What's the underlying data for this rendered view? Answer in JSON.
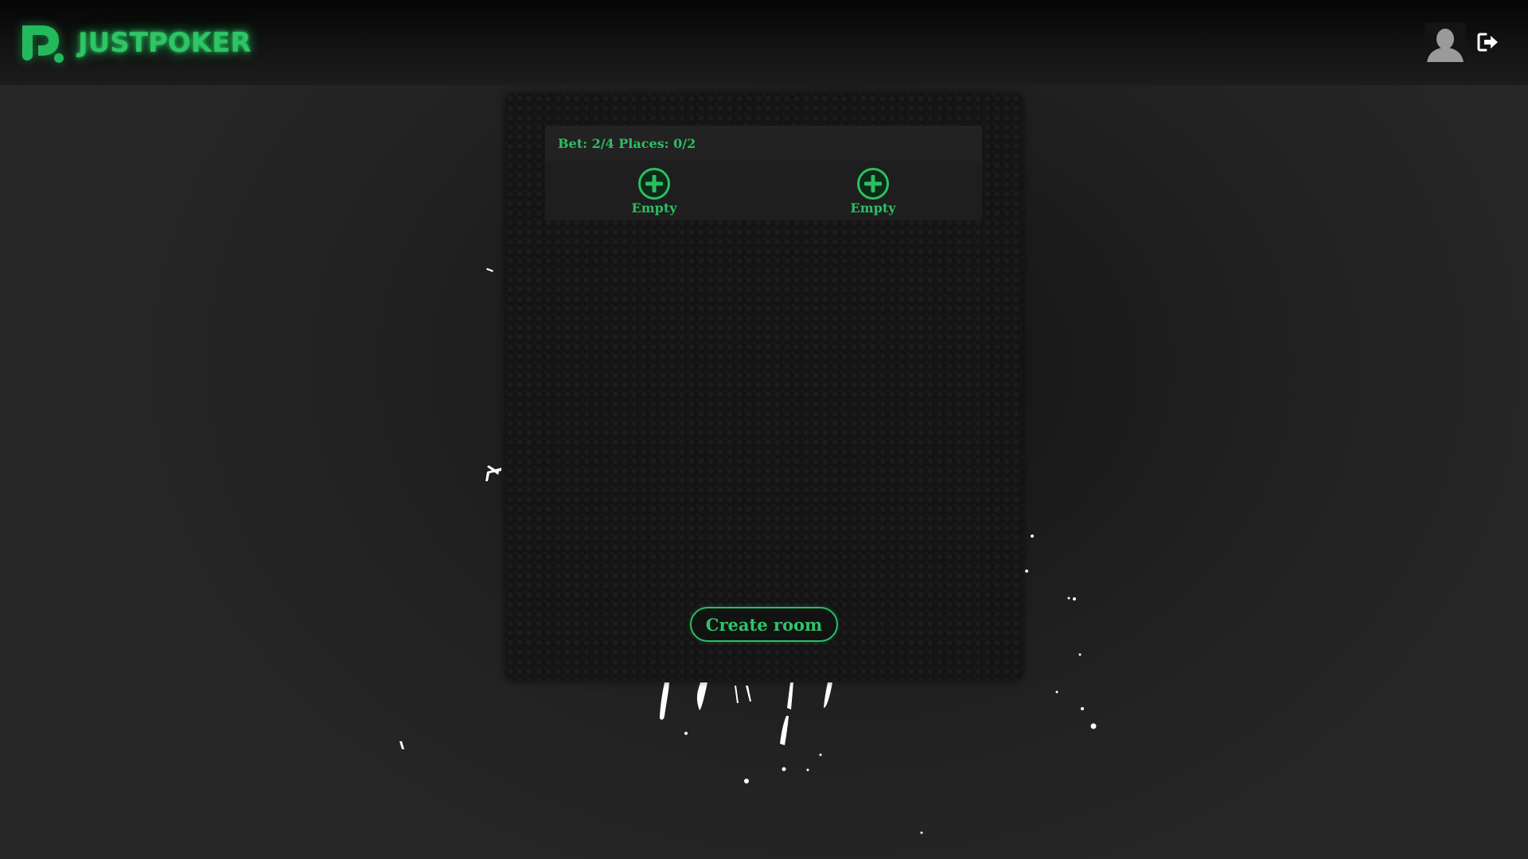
{
  "header": {
    "brand_name": "JUSTPOKER",
    "logo_icon": "justpoker-logo-icon",
    "avatar_icon": "user-avatar-icon",
    "logout_icon": "logout-icon"
  },
  "lobby": {
    "rooms": [
      {
        "bet_label": "Bet: 2/4",
        "places_label": "Places: 0/2",
        "seats": [
          {
            "label": "Empty",
            "icon": "plus-circle-icon"
          },
          {
            "label": "Empty",
            "icon": "plus-circle-icon"
          }
        ]
      }
    ],
    "create_room_label": "Create room"
  },
  "colors": {
    "accent": "#2bbf63",
    "background": "#1c1c1c",
    "panel": "#141414",
    "card": "#1e1e1e"
  }
}
